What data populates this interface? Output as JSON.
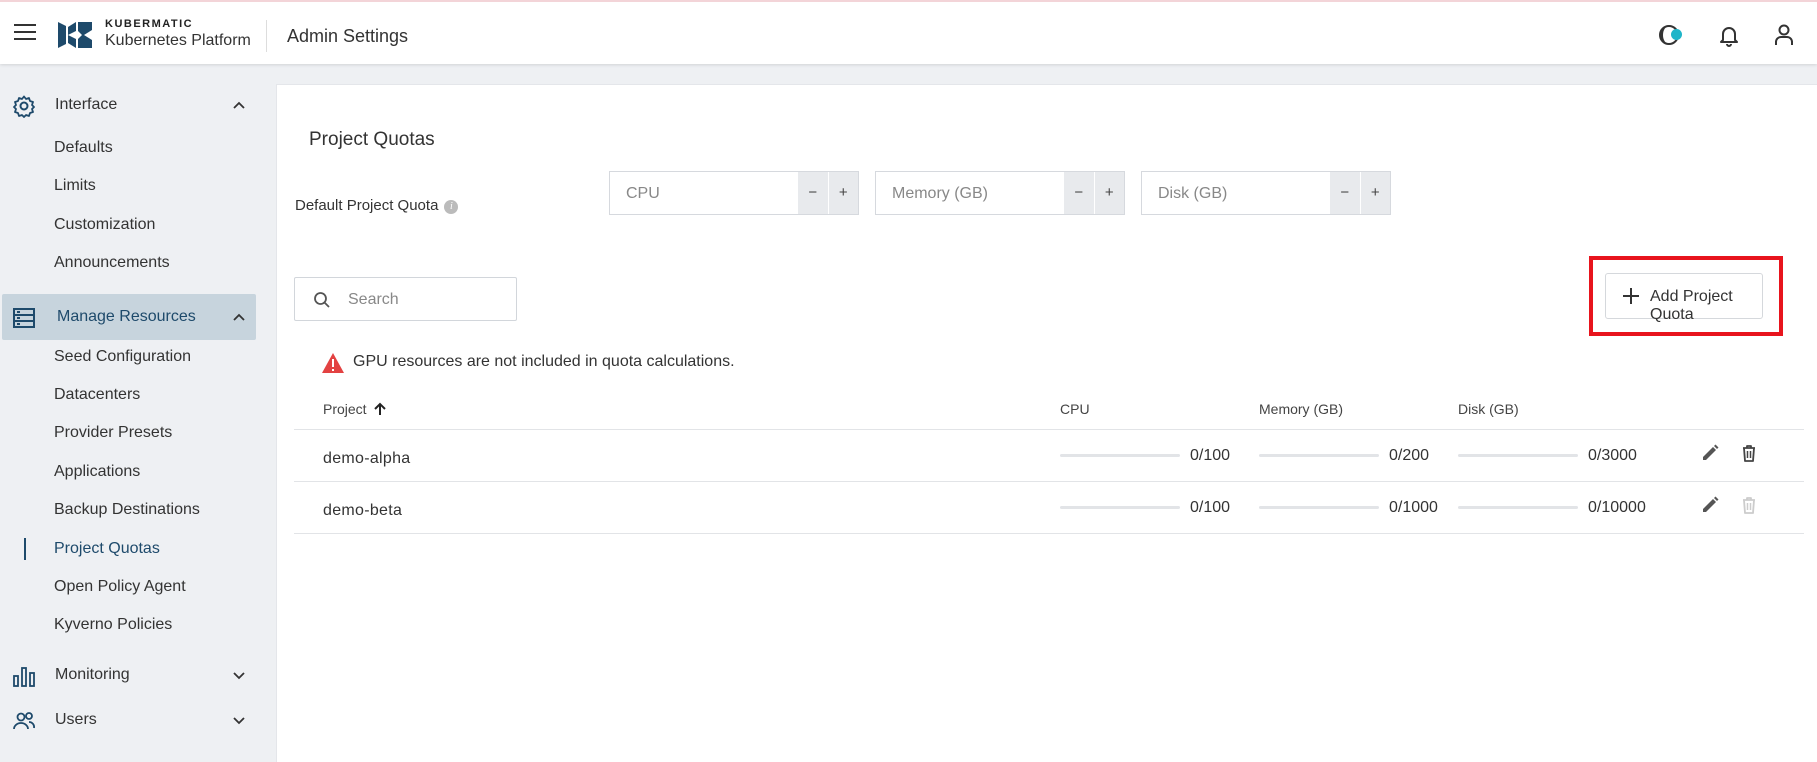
{
  "header": {
    "brand_top": "KUBERMATIC",
    "brand_sub": "Kubernetes Platform",
    "title": "Admin Settings",
    "accent_dot": "#1fb5c9"
  },
  "sidebar": {
    "sections": [
      {
        "label": "Interface",
        "expanded": true,
        "items": [
          "Defaults",
          "Limits",
          "Customization",
          "Announcements"
        ]
      },
      {
        "label": "Manage Resources",
        "expanded": true,
        "active": true,
        "items": [
          "Seed Configuration",
          "Datacenters",
          "Provider Presets",
          "Applications",
          "Backup Destinations",
          "Project Quotas",
          "Open Policy Agent",
          "Kyverno Policies"
        ]
      },
      {
        "label": "Monitoring",
        "expanded": false
      },
      {
        "label": "Users",
        "expanded": false
      }
    ],
    "active_item": "Project Quotas"
  },
  "main": {
    "title": "Project Quotas",
    "default_quota_label": "Default Project Quota",
    "fields": {
      "cpu_placeholder": "CPU",
      "memory_placeholder": "Memory (GB)",
      "disk_placeholder": "Disk (GB)",
      "minus": "−",
      "plus": "+"
    },
    "search_placeholder": "Search",
    "add_button_label": "Add Project Quota",
    "warning": "GPU resources are not included in quota calculations.",
    "columns": [
      "Project",
      "CPU",
      "Memory (GB)",
      "Disk (GB)"
    ],
    "sort_column": "Project",
    "sort_direction": "ascending",
    "rows": [
      {
        "project": "demo-alpha",
        "cpu": "0/100",
        "memory": "0/200",
        "disk": "0/3000",
        "cpu_used": 0,
        "memory_used": 0,
        "disk_used": 0,
        "delete_enabled": true
      },
      {
        "project": "demo-beta",
        "cpu": "0/100",
        "memory": "0/1000",
        "disk": "0/10000",
        "cpu_used": 0,
        "memory_used": 0,
        "disk_used": 0,
        "delete_enabled": false
      }
    ]
  },
  "colors": {
    "accent": "#1e4a6b",
    "highlight": "#e8141d",
    "warning": "#e34242",
    "active_nav_bg": "#c7d4dd"
  }
}
